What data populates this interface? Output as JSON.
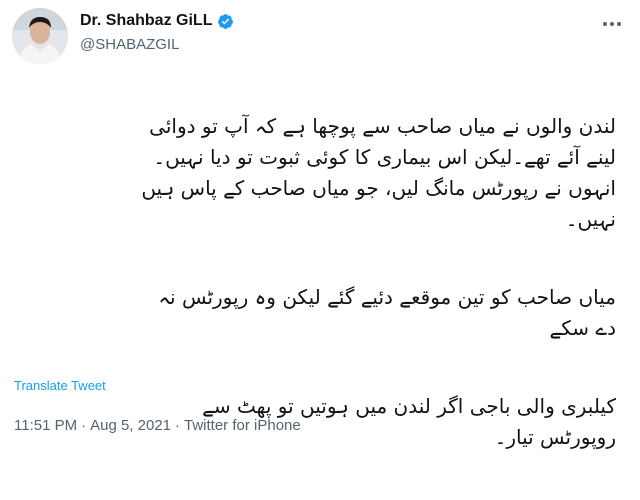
{
  "author": {
    "display_name": "Dr. Shahbaz GiLL",
    "handle": "@SHABAZGIL",
    "verified": true,
    "avatar": "profile-photo"
  },
  "tweet": {
    "paragraphs": [
      "لندن والوں نے میاں صاحب سے پوچھا ہے کہ آپ تو دوائی\nلینے آئے تھے۔لیکن اس بیماری کا کوئی ثبوت تو دیا نہیں۔\nانہوں نے رپورٹس مانگ لیں، جو میاں صاحب کے پاس ہیں\nنہیں۔",
      "میاں صاحب کو تین موقعے دئیے گئے لیکن وہ رپورٹس نہ\nدے سکے",
      "کیلبری والی باجی اگر لندن میں ہوتیں تو پھٹ سے\nروپورٹس تیار۔"
    ],
    "translate_label": "Translate Tweet",
    "time": "11:51 PM",
    "date": "Aug 5, 2021",
    "source": "Twitter for iPhone",
    "separator": "·"
  },
  "colors": {
    "accent": "#1d9bf0",
    "secondary_text": "#536471",
    "primary_text": "#0f1419"
  },
  "icons": {
    "verified": "verified-badge-icon",
    "more": "more-options-icon"
  }
}
